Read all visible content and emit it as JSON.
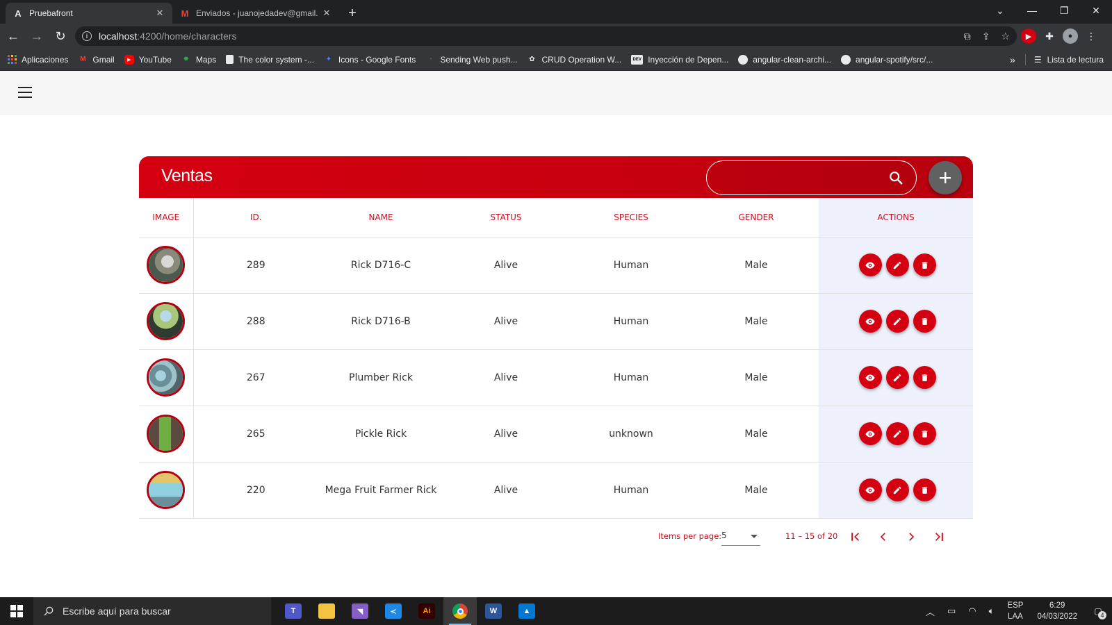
{
  "browser": {
    "tabs": [
      {
        "title": "Pruebafront",
        "favicon": "angular-icon",
        "active": true
      },
      {
        "title": "Enviados - juanojedadev@gmail.",
        "favicon": "gmail-icon",
        "active": false
      }
    ],
    "url_host": "localhost",
    "url_rest": ":4200/home/characters",
    "bookmarks": [
      {
        "label": "Aplicaciones",
        "icon": "apps-grid-icon"
      },
      {
        "label": "Gmail",
        "icon": "gmail-icon"
      },
      {
        "label": "YouTube",
        "icon": "youtube-icon"
      },
      {
        "label": "Maps",
        "icon": "maps-icon"
      },
      {
        "label": "The color system -...",
        "icon": "bookmark-icon"
      },
      {
        "label": "Icons - Google Fonts",
        "icon": "fonts-icon"
      },
      {
        "label": "Sending Web push...",
        "icon": "rss-icon"
      },
      {
        "label": "CRUD Operation W...",
        "icon": "crud-icon"
      },
      {
        "label": "Inyección de Depen...",
        "icon": "dev-icon"
      },
      {
        "label": "angular-clean-archi...",
        "icon": "github-icon"
      },
      {
        "label": "angular-spotify/src/...",
        "icon": "github-icon"
      }
    ],
    "reading_list": "Lista de lectura"
  },
  "app": {
    "card_title": "Ventas",
    "search_placeholder": "",
    "columns": {
      "image": "IMAGE",
      "id": "ID.",
      "name": "NAME",
      "status": "STATUS",
      "species": "SPECIES",
      "gender": "GENDER",
      "actions": "ACTIONS"
    },
    "rows": [
      {
        "id": "289",
        "name": "Rick D716-C",
        "status": "Alive",
        "species": "Human",
        "gender": "Male"
      },
      {
        "id": "288",
        "name": "Rick D716-B",
        "status": "Alive",
        "species": "Human",
        "gender": "Male"
      },
      {
        "id": "267",
        "name": "Plumber Rick",
        "status": "Alive",
        "species": "Human",
        "gender": "Male"
      },
      {
        "id": "265",
        "name": "Pickle Rick",
        "status": "Alive",
        "species": "unknown",
        "gender": "Male"
      },
      {
        "id": "220",
        "name": "Mega Fruit Farmer Rick",
        "status": "Alive",
        "species": "Human",
        "gender": "Male"
      }
    ],
    "paginator": {
      "items_per_page_label": "Items per page:",
      "items_per_page_value": "5",
      "range_label": "11 – 15 of 20"
    },
    "colors": {
      "primary": "#d40011",
      "fab": "#616161",
      "actions_bg": "#eef1fb"
    }
  },
  "taskbar": {
    "search_placeholder": "Escribe aquí para buscar",
    "lang_top": "ESP",
    "lang_bottom": "LAA",
    "time": "6:29",
    "date": "04/03/2022",
    "notifications": "4"
  }
}
